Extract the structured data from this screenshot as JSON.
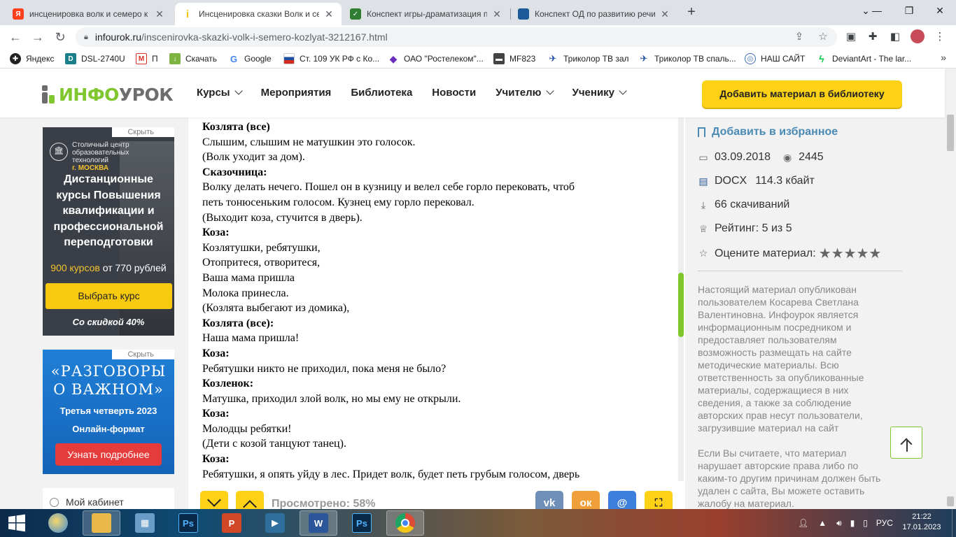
{
  "browser": {
    "tabs": [
      {
        "title": "инсценировка волк и семеро к",
        "favicon": "yandex-icon",
        "color": "#fc3f1d",
        "glyph": "Я"
      },
      {
        "title": "Инсценировка сказки Волк и се",
        "favicon": "infourok-icon",
        "color": "#fcd116",
        "glyph": "i"
      },
      {
        "title": "Конспект игры-драматизация п",
        "favicon": "checkmark-icon",
        "color": "#2e7d32",
        "glyph": "✓"
      },
      {
        "title": "Конспект ОД по развитию речи",
        "favicon": "book-icon",
        "color": "#1e5a99",
        "glyph": "▮"
      }
    ],
    "url_domain": "infourok.ru",
    "url_path": "/inscenirovka-skazki-volk-i-semero-kozlyat-3212167.html",
    "bookmarks": [
      {
        "label": "Яндекс",
        "icon": "yandex-icon",
        "color": "#222"
      },
      {
        "label": "DSL-2740U",
        "icon": "dlink-icon",
        "color": "#1a7f8a"
      },
      {
        "label": "П",
        "icon": "gmail-icon",
        "color": "#d93025"
      },
      {
        "label": "Скачать",
        "icon": "download-icon",
        "color": "#7cb342"
      },
      {
        "label": "Google",
        "icon": "google-icon",
        "color": "#4285f4"
      },
      {
        "label": "Ст. 109 УК РФ с Ко...",
        "icon": "russia-flag-icon",
        "color": "#1c4fa0"
      },
      {
        "label": "ОАО \"Ростелеком\"...",
        "icon": "rostelecom-icon",
        "color": "#6b2fbf"
      },
      {
        "label": "MF823",
        "icon": "modem-icon",
        "color": "#444"
      },
      {
        "label": "Триколор ТВ зал",
        "icon": "tricolor-icon",
        "color": "#1d4ea1"
      },
      {
        "label": "Триколор ТВ спаль...",
        "icon": "tricolor-icon",
        "color": "#1d4ea1"
      },
      {
        "label": "НАШ САЙТ",
        "icon": "site-icon",
        "color": "#3b6fb6"
      },
      {
        "label": "DeviantArt - The lar...",
        "icon": "deviantart-icon",
        "color": "#05cc47"
      }
    ]
  },
  "site": {
    "logo_green": "ИНФО",
    "logo_gray": "УРОК",
    "nav": [
      {
        "label": "Курсы",
        "dropdown": true
      },
      {
        "label": "Мероприятия",
        "dropdown": false
      },
      {
        "label": "Библиотека",
        "dropdown": false
      },
      {
        "label": "Новости",
        "dropdown": false
      },
      {
        "label": "Учителю",
        "dropdown": true
      },
      {
        "label": "Ученику",
        "dropdown": true
      }
    ],
    "add_button": "Добавить материал в библиотеку"
  },
  "ads": {
    "hide_label": "Скрыть",
    "ad1": {
      "org_line1": "Столичный центр",
      "org_line2": "образовательных",
      "org_line3": "технологий",
      "org_city": "г. МОСКВА",
      "headline": "Дистанционные курсы Повышения квалификации и профессиональной переподготовки",
      "price_accent": "900 курсов",
      "price_rest": " от 770 рублей",
      "cta": "Выбрать курс",
      "discount": "Со скидкой 40%"
    },
    "ad2": {
      "title_line1": "«РАЗГОВОРЫ",
      "title_line2": "О ВАЖНОМ»",
      "line2": "Третья четверть 2023",
      "line3": "Онлайн-формат",
      "cta": "Узнать подробнее"
    },
    "cabinet": "Мой кабинет"
  },
  "document": {
    "lines": [
      {
        "text": "",
        "bold": false,
        "cut": true
      },
      {
        "text": "Козлята (все)",
        "bold": true
      },
      {
        "text": "Слышим, слышим не матушкин это голосок.",
        "bold": false
      },
      {
        "text": "(Волк уходит за дом).",
        "bold": false
      },
      {
        "text": "Сказочница:",
        "bold": true
      },
      {
        "text": "Волку делать нечего. Пошел он в кузницу и велел себе горло перековать, чтоб",
        "bold": false
      },
      {
        "text": "петь тонюсеньким голосом. Кузнец ему горло перековал.",
        "bold": false
      },
      {
        "text": "(Выходит коза, стучится в дверь).",
        "bold": false
      },
      {
        "text": "Коза:",
        "bold": true
      },
      {
        "text": "Козлятушки, ребятушки,",
        "bold": false
      },
      {
        "text": "Отопритеся, отворитеся,",
        "bold": false
      },
      {
        "text": "Ваша мама пришла",
        "bold": false
      },
      {
        "text": "Молока принесла.",
        "bold": false
      },
      {
        "text": "(Козлята выбегают из домика),",
        "bold": false
      },
      {
        "text": "Козлята (все):",
        "bold": true
      },
      {
        "text": "Наша мама пришла!",
        "bold": false
      },
      {
        "text": "Коза:",
        "bold": true
      },
      {
        "text": "Ребятушки никто не приходил, пока меня не было?",
        "bold": false
      },
      {
        "text": "Козленок:",
        "bold": true
      },
      {
        "text": "Матушка, приходил злой волк, но мы ему не открыли.",
        "bold": false
      },
      {
        "text": "Коза:",
        "bold": true
      },
      {
        "text": "Молодцы ребятки!",
        "bold": false
      },
      {
        "text": "(Дети с козой танцуют танец).",
        "bold": false
      },
      {
        "text": "Коза:",
        "bold": true
      },
      {
        "text": "Ребятушки, я опять уйду в лес. Придет волк, будет петь грубым голосом, дверь",
        "bold": false
      }
    ],
    "viewed": "Просмотрено: 58%",
    "viewed_fraction": 0.58,
    "share": [
      {
        "label": "ВК",
        "glyph": "vk",
        "icon": "vk-icon",
        "color": "#6f8fb8"
      },
      {
        "label": "ОК",
        "glyph": "ок",
        "icon": "odnoklassniki-icon",
        "color": "#f0a03a"
      },
      {
        "label": "Mail",
        "glyph": "@",
        "icon": "mail-icon",
        "color": "#3c7fdc"
      }
    ]
  },
  "sidebar": {
    "favorite": "Добавить в избранное",
    "date": "03.09.2018",
    "views": "2445",
    "format": "DOCX",
    "size": "114.3 кбайт",
    "downloads": "66 скачиваний",
    "rating": "Рейтинг: 5 из 5",
    "rate_label": "Оцените материал:",
    "stars": 5,
    "notice1": "Настоящий материал опубликован пользователем Косарева Светлана Валентиновна. Инфоурок является информационным посредником и предоставляет пользователям возможность размещать на сайте методические материалы. Всю ответственность за опубликованные материалы, содержащиеся в них сведения, а также за соблюдение авторских прав несут пользователи, загрузившие материал на сайт",
    "notice2": "Если Вы считаете, что материал нарушает авторские права либо по каким-то другим причинам должен быть удален с сайта, Вы можете оставить жалобу на материал."
  },
  "taskbar": {
    "apps": [
      {
        "name": "paint-icon",
        "label": "",
        "color": "#3d8bd6"
      },
      {
        "name": "explorer-icon",
        "label": "",
        "color": "#e8b84a"
      },
      {
        "name": "resource-monitor-icon",
        "label": "",
        "color": "#6a9cc8"
      },
      {
        "name": "photoshop-icon",
        "label": "Ps",
        "color": "#0a2a48"
      },
      {
        "name": "powerpoint-icon",
        "label": "P",
        "color": "#d24726"
      },
      {
        "name": "movie-maker-icon",
        "label": "",
        "color": "#2e6f9e"
      },
      {
        "name": "word-icon",
        "label": "W",
        "color": "#2b579a"
      },
      {
        "name": "photoshop-icon-2",
        "label": "Ps",
        "color": "#0a2a48"
      },
      {
        "name": "chrome-icon",
        "label": "",
        "color": "#dd4b39"
      }
    ],
    "language": "РУС",
    "time": "21:22",
    "date": "17.01.2023"
  }
}
